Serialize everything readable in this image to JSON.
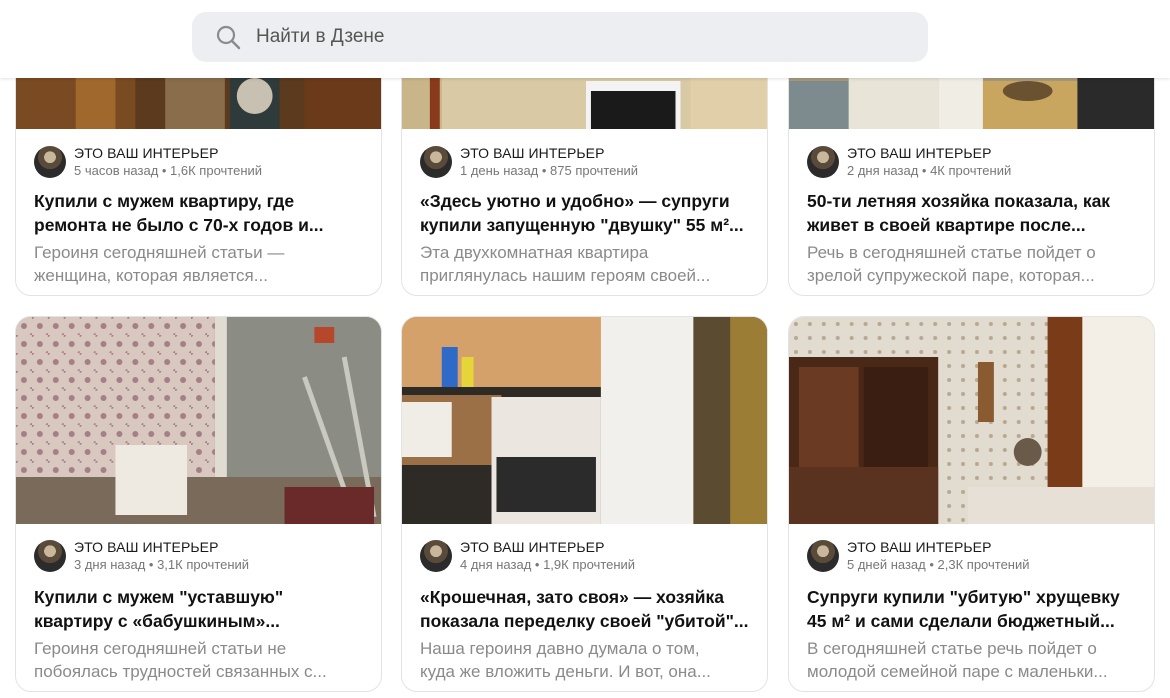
{
  "search": {
    "placeholder": "Найти в Дзене"
  },
  "cards": [
    {
      "channel": "ЭТО ВАШ ИНТЕРЬЕР",
      "stats": "5 часов назад • 1,6К прочтений",
      "title_1": "Купили с мужем квартиру, где",
      "title_2": "ремонта не было с 70-х годов и...",
      "desc_1": "Героиня сегодняшней статьи —",
      "desc_2": "женщина, которая является..."
    },
    {
      "channel": "ЭТО ВАШ ИНТЕРЬЕР",
      "stats": "1 день назад • 875 прочтений",
      "title_1": "«Здесь уютно и удобно» — супруги",
      "title_2": "купили запущенную \"двушку\" 55 м²...",
      "desc_1": "Эта двухкомнатная квартира",
      "desc_2": "приглянулась нашим героям своей..."
    },
    {
      "channel": "ЭТО ВАШ ИНТЕРЬЕР",
      "stats": "2 дня назад • 4К прочтений",
      "title_1": "50-ти летняя хозяйка показала, как",
      "title_2": "живет в своей квартире после...",
      "desc_1": "Речь в сегодняшней статье пойдет о",
      "desc_2": "зрелой супружеской паре, которая..."
    },
    {
      "channel": "ЭТО ВАШ ИНТЕРЬЕР",
      "stats": "3 дня назад • 3,1К прочтений",
      "title_1": "Купили с мужем \"уставшую\"",
      "title_2": "квартиру с «бабушкиным»...",
      "desc_1": "Героиня сегодняшней статьи не",
      "desc_2": "побоялась трудностей связанных с..."
    },
    {
      "channel": "ЭТО ВАШ ИНТЕРЬЕР",
      "stats": "4 дня назад • 1,9К прочтений",
      "title_1": "«Крошечная, зато своя» — хозяйка",
      "title_2": "показала переделку своей \"убитой\"...",
      "desc_1": "Наша героиня давно думала о том,",
      "desc_2": "куда же вложить деньги. И вот, она..."
    },
    {
      "channel": "ЭТО ВАШ ИНТЕРЬЕР",
      "stats": "5 дней назад • 2,3К прочтений",
      "title_1": "Супруги купили \"убитую\" хрущевку",
      "title_2": "45 м² и сами сделали бюджетный...",
      "desc_1": "В сегодняшней статье речь пойдет о",
      "desc_2": "молодой семейной паре с маленьки..."
    }
  ]
}
